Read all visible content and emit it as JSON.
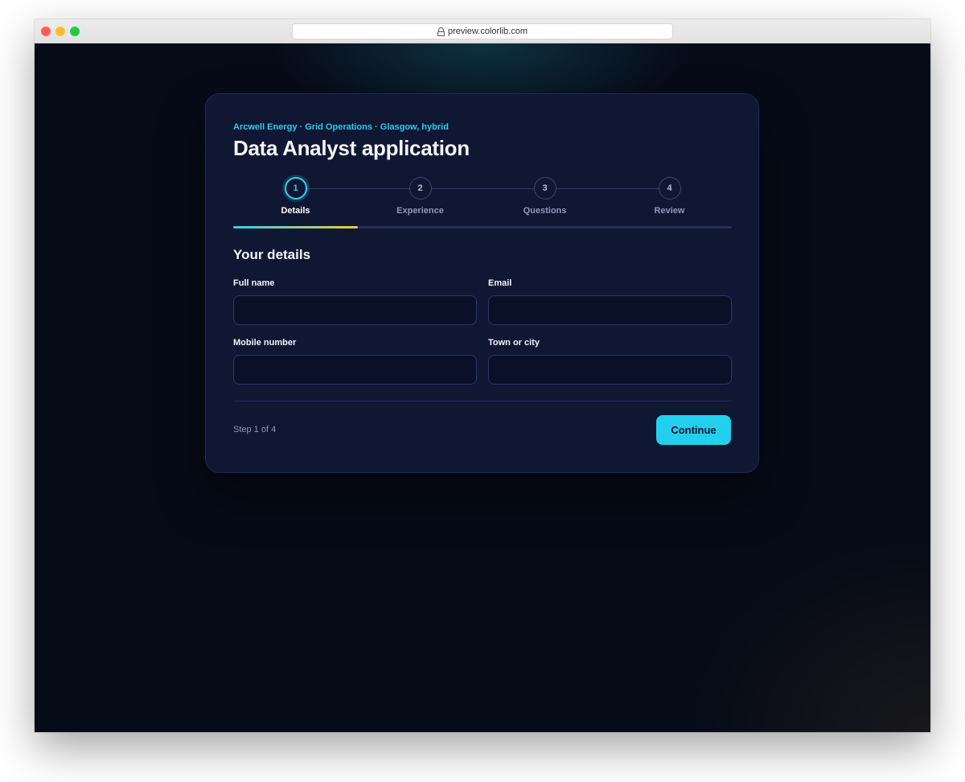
{
  "browser": {
    "url": "preview.colorlib.com"
  },
  "form": {
    "eyebrow": "Arcwell Energy · Grid Operations · Glasgow, hybrid",
    "title": "Data Analyst application",
    "steps": [
      {
        "number": "1",
        "label": "Details",
        "active": true
      },
      {
        "number": "2",
        "label": "Experience",
        "active": false
      },
      {
        "number": "3",
        "label": "Questions",
        "active": false
      },
      {
        "number": "4",
        "label": "Review",
        "active": false
      }
    ],
    "progress_fraction": 0.25,
    "section_title": "Your details",
    "fields": {
      "full_name": {
        "label": "Full name",
        "value": ""
      },
      "email": {
        "label": "Email",
        "value": ""
      },
      "mobile": {
        "label": "Mobile number",
        "value": ""
      },
      "town": {
        "label": "Town or city",
        "value": ""
      }
    },
    "step_count": "Step 1 of 4",
    "continue_label": "Continue"
  },
  "colors": {
    "accent": "#22d0ee",
    "progress_end": "#f0c93a",
    "card_bg": "#0f1733",
    "page_bg": "#070b18"
  }
}
